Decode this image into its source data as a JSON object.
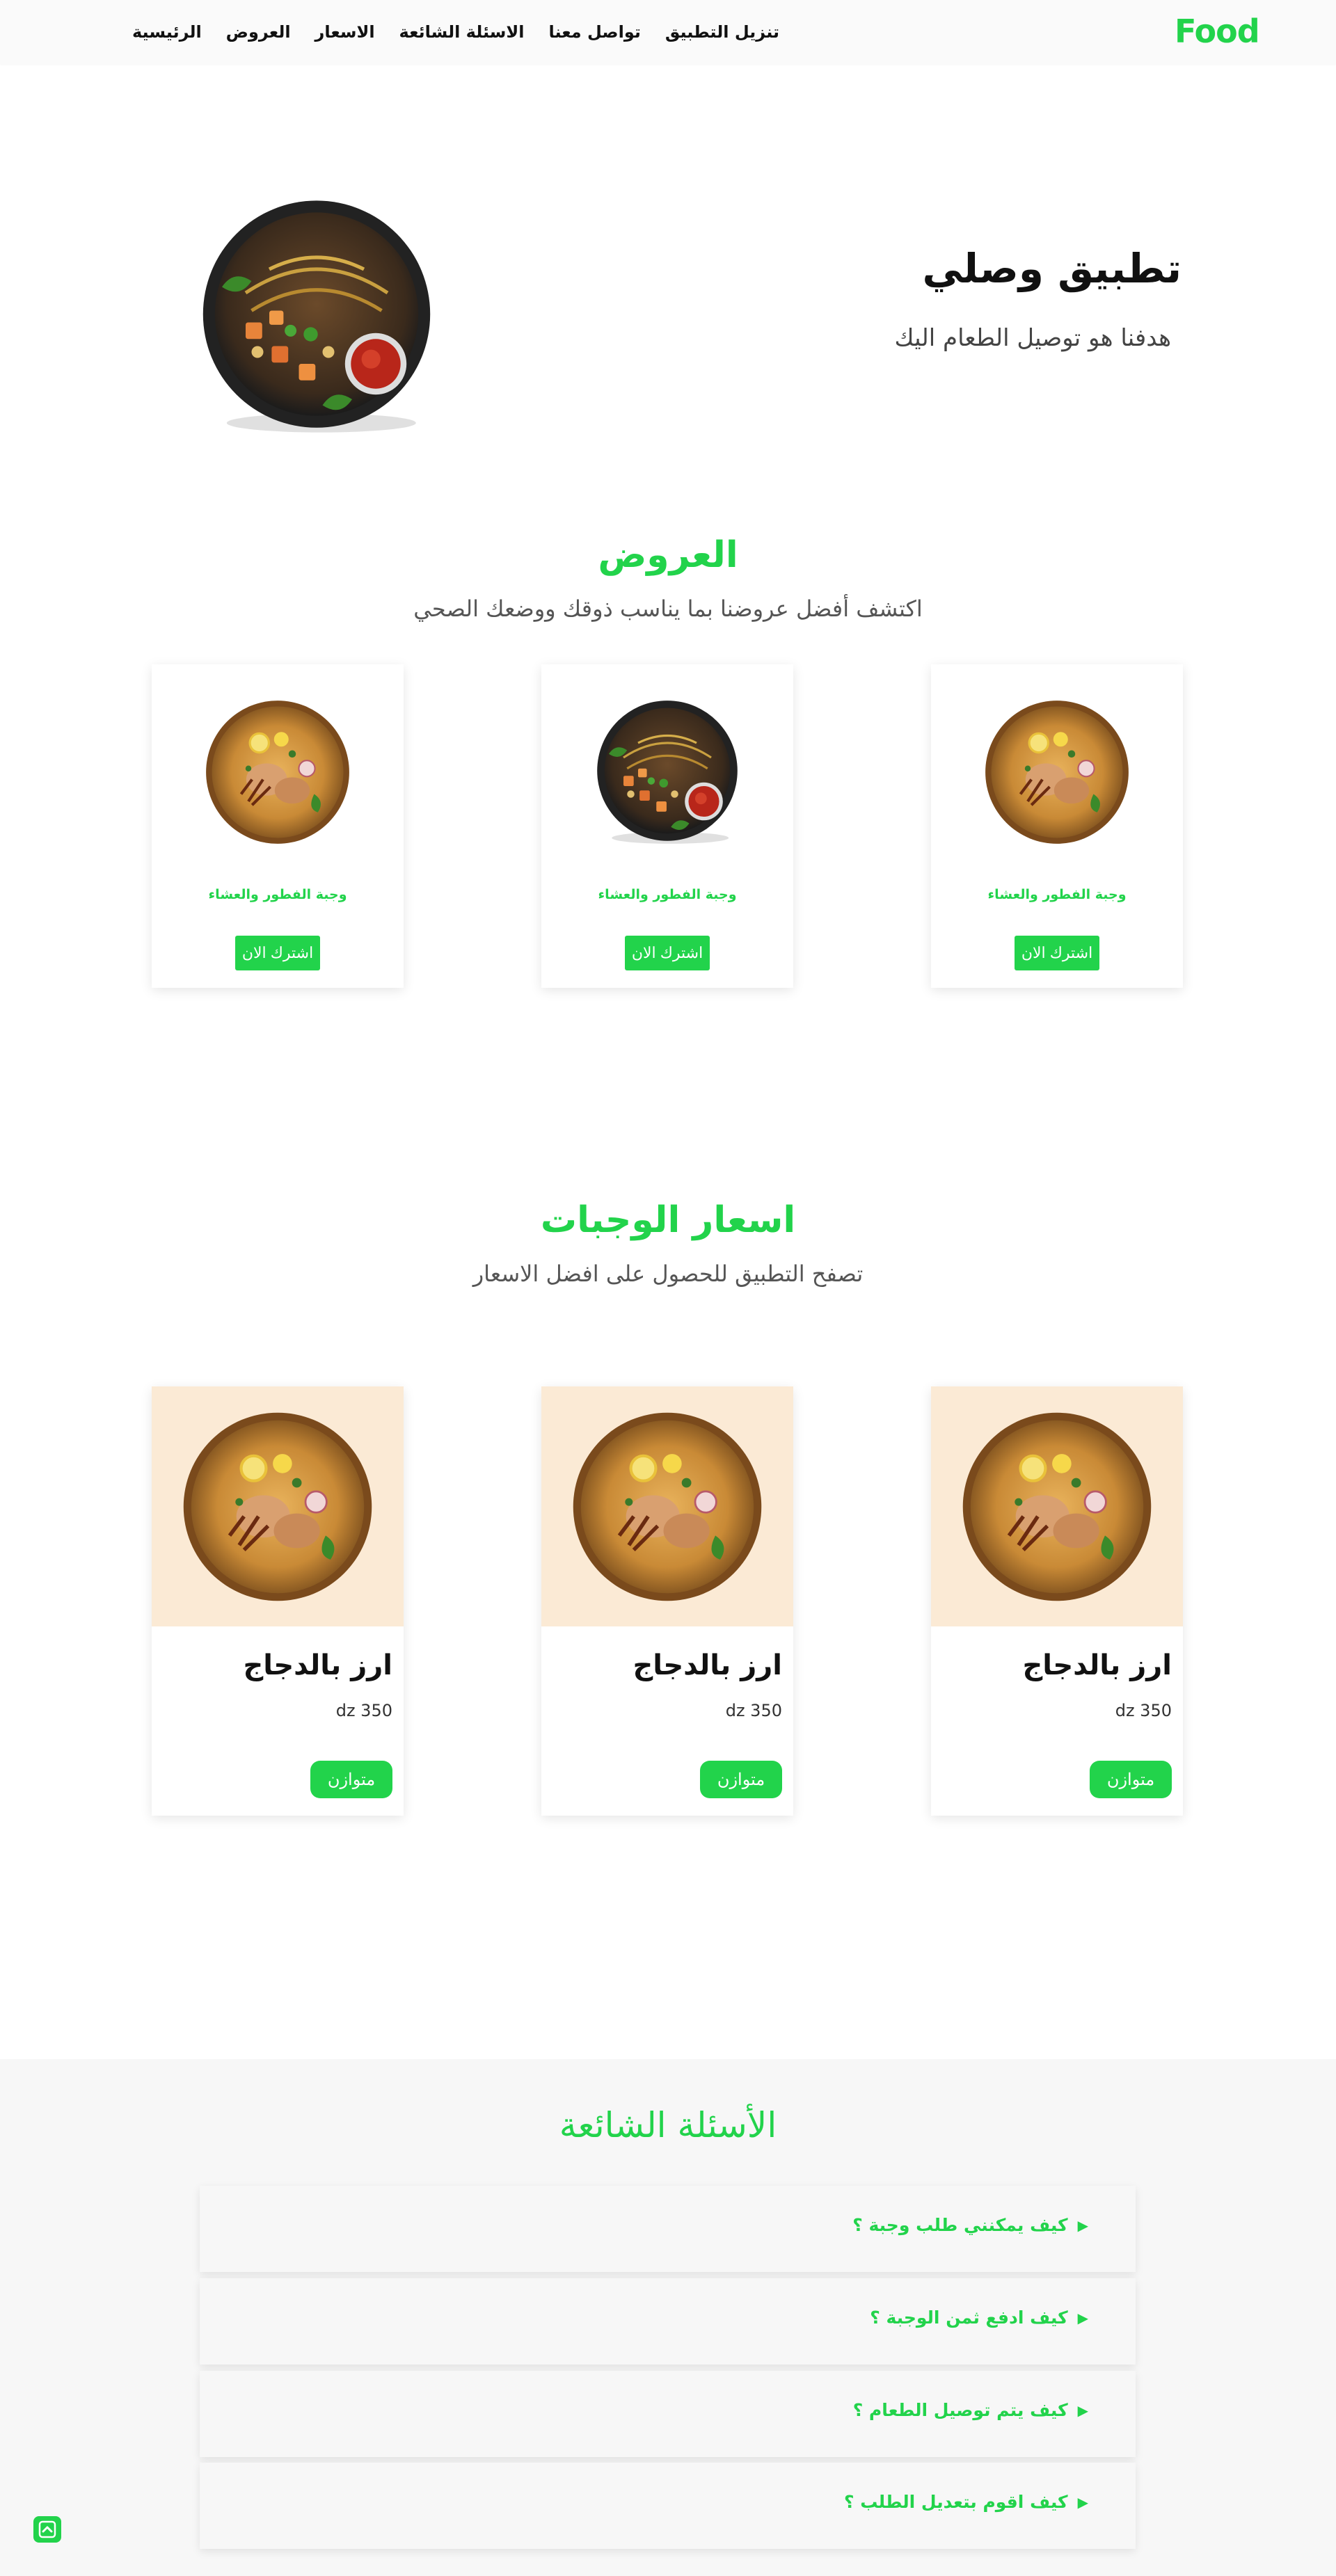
{
  "nav": {
    "logo": "Food",
    "links": [
      "الرئيسية",
      "العروض",
      "الاسعار",
      "الاسئلة الشائعة",
      "تواصل معنا",
      "تنزيل التطبيق"
    ]
  },
  "hero": {
    "title": "تطبيق وصلي",
    "subtitle": "هدفنا هو توصيل الطعام اليك",
    "image_icon": "food-bowl-image"
  },
  "offers": {
    "title": "العروض",
    "subtitle": "اكتشف أفضل عروضنا بما يناسب ذوقك ووضعك الصحي",
    "cards": [
      {
        "label": "وجبة الفطور والعشاء",
        "button": "اشترك الان",
        "image_icon": "biryani-plate-image"
      },
      {
        "label": "وجبة الفطور والعشاء",
        "button": "اشترك الان",
        "image_icon": "food-bowl-image"
      },
      {
        "label": "وجبة الفطور والعشاء",
        "button": "اشترك الان",
        "image_icon": "biryani-plate-image"
      }
    ]
  },
  "prices": {
    "title": "اسعار الوجبات",
    "subtitle": "تصفح التطبيق للحصول على افضل الاسعار",
    "cards": [
      {
        "name": "ارز بالدجاج",
        "price": "dz 350",
        "tag": "متوازن"
      },
      {
        "name": "ارز بالدجاج",
        "price": "dz 350",
        "tag": "متوازن"
      },
      {
        "name": "ارز بالدجاج",
        "price": "dz 350",
        "tag": "متوازن"
      }
    ]
  },
  "faq": {
    "title": "الأسئلة الشائعة",
    "items": [
      "كيف يمكنني طلب وجبة ؟",
      "كيف ادفع ثمن الوجبة ؟",
      "كيف يتم توصيل الطعام ؟",
      "كيف اقوم بتعديل الطلب ؟"
    ]
  },
  "colors": {
    "accent": "#22d34b",
    "card_image_bg": "#fbead5",
    "faq_bg": "#f7f7f7"
  },
  "scroll_top_icon": "chevron-up-icon"
}
